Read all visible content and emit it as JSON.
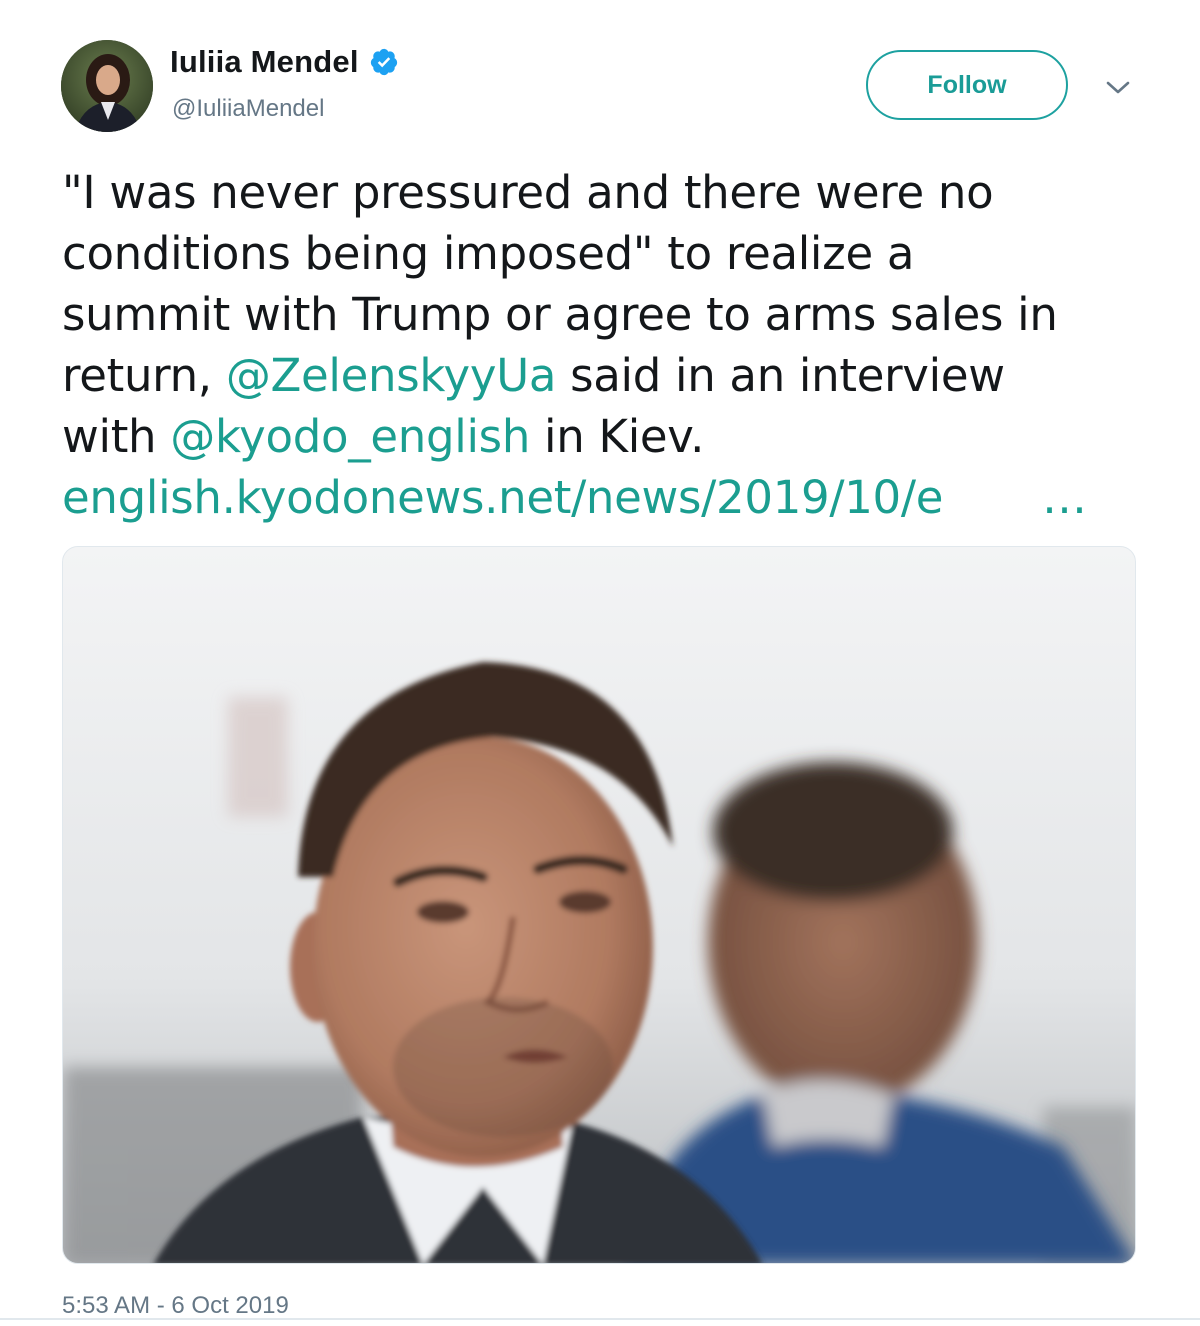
{
  "author": {
    "display_name": "Iuliia Mendel",
    "handle": "@IuliiaMendel",
    "verified": true
  },
  "actions": {
    "follow_label": "Follow",
    "caret_icon": "chevron-down-icon"
  },
  "tweet": {
    "line1": "\"I was never pressured and there were no",
    "line2": "conditions being imposed\" to realize a",
    "line3": "summit with Trump or agree to arms sales in",
    "line4_before": "return, ",
    "mention1": "@ZelenskyyUa",
    "line4_after": " said in an interview",
    "line5_before": "with ",
    "mention2": "@kyodo_english",
    "line5_after": " in Kiev.",
    "url_text": "english.kyodonews.net/news/2019/10/e",
    "url_ellipsis": "…"
  },
  "timestamp": "5:53 AM - 6 Oct 2019",
  "colors": {
    "accent": "#1b9e90",
    "verified": "#1da1f2",
    "muted": "#657786",
    "text": "#14171a"
  }
}
